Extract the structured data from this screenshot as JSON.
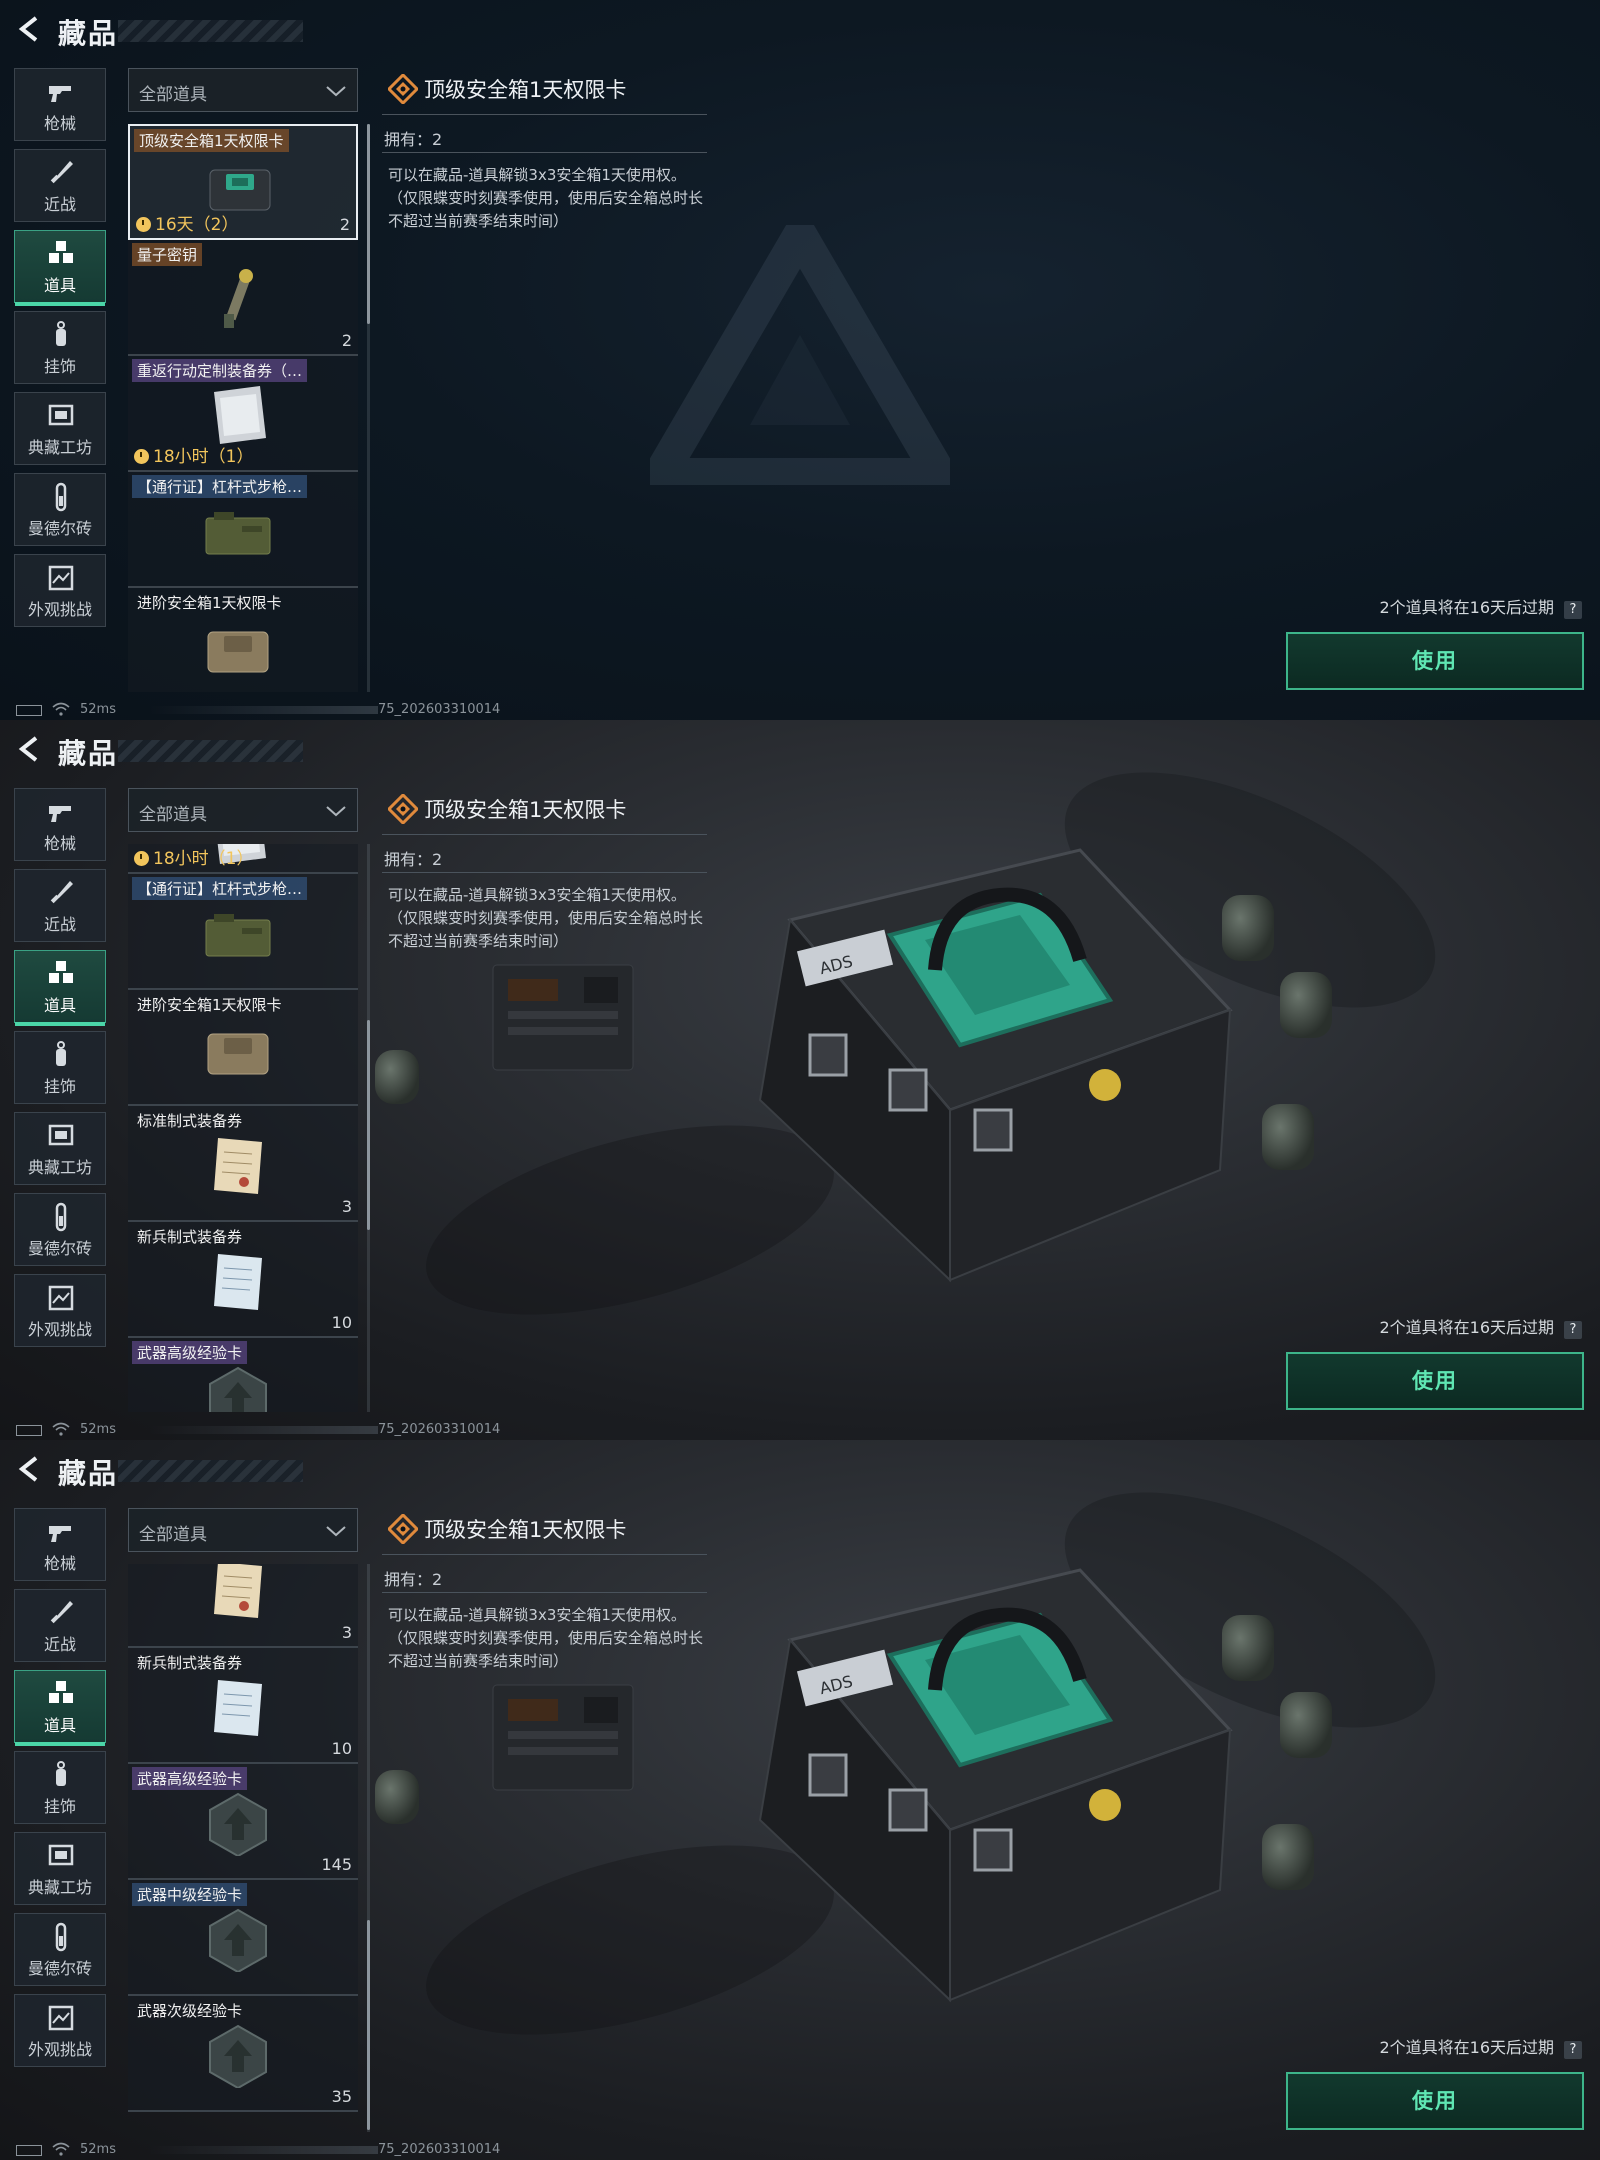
{
  "header": {
    "title": "藏品"
  },
  "categories": [
    {
      "label": "枪械",
      "icon": "gun-icon"
    },
    {
      "label": "近战",
      "icon": "knife-icon"
    },
    {
      "label": "道具",
      "icon": "cubes-icon",
      "active": true
    },
    {
      "label": "挂饰",
      "icon": "charm-icon"
    },
    {
      "label": "典藏工坊",
      "icon": "frame-icon"
    },
    {
      "label": "曼德尔砖",
      "icon": "brick-icon"
    },
    {
      "label": "外观挑战",
      "icon": "image-icon"
    }
  ],
  "filter": {
    "label": "全部道具"
  },
  "detail": {
    "title": "顶级安全箱1天权限卡",
    "own": "拥有：2",
    "description": "可以在藏品-道具解锁3x3安全箱1天使用权。（仅限蝶变时刻赛季使用，使用后安全箱总时长不超过当前赛季结束时间）"
  },
  "footer": {
    "expire_note": "2个道具将在16天后过期",
    "help": "?",
    "use_label": "使用"
  },
  "status": {
    "ping": "52ms",
    "build": "75_202603310014"
  },
  "panels": [
    {
      "items": [
        {
          "name": "顶级安全箱1天权限卡",
          "tag": "orange",
          "timer": "16天（2）",
          "count": "2",
          "selected": true,
          "thumb": "safe-case"
        },
        {
          "name": "量子密钥",
          "tag": "orange",
          "timer": "",
          "count": "2",
          "thumb": "key"
        },
        {
          "name": "重返行动定制装备券（…",
          "tag": "purple",
          "timer": "18小时（1）",
          "count": "",
          "thumb": "paper"
        },
        {
          "name": "【通行证】杠杆式步枪…",
          "tag": "blue",
          "timer": "",
          "count": "",
          "thumb": "ammo-box"
        },
        {
          "name": "进阶安全箱1天权限卡",
          "tag": "none",
          "timer": "",
          "count": "",
          "thumb": "safe-case-tan"
        }
      ]
    },
    {
      "items": [
        {
          "name": "",
          "tag": "none",
          "timer": "18小时（1）",
          "count": "",
          "thumb": "paper",
          "partial": true
        },
        {
          "name": "【通行证】杠杆式步枪…",
          "tag": "blue",
          "timer": "",
          "count": "",
          "thumb": "ammo-box"
        },
        {
          "name": "进阶安全箱1天权限卡",
          "tag": "none",
          "timer": "",
          "count": "",
          "thumb": "safe-case-tan"
        },
        {
          "name": "标准制式装备券",
          "tag": "none",
          "timer": "",
          "count": "3",
          "thumb": "doc"
        },
        {
          "name": "新兵制式装备券",
          "tag": "none",
          "timer": "",
          "count": "10",
          "thumb": "doc-blue"
        },
        {
          "name": "武器高级经验卡",
          "tag": "purple",
          "timer": "",
          "count": "",
          "thumb": "hex"
        }
      ]
    },
    {
      "items": [
        {
          "name": "",
          "tag": "none",
          "timer": "",
          "count": "3",
          "thumb": "doc",
          "partial": true
        },
        {
          "name": "新兵制式装备券",
          "tag": "none",
          "timer": "",
          "count": "10",
          "thumb": "doc-blue"
        },
        {
          "name": "武器高级经验卡",
          "tag": "purple",
          "timer": "",
          "count": "145",
          "thumb": "hex"
        },
        {
          "name": "武器中级经验卡",
          "tag": "blue",
          "timer": "",
          "count": "",
          "thumb": "hex"
        },
        {
          "name": "武器次级经验卡",
          "tag": "none",
          "timer": "",
          "count": "35",
          "thumb": "hex"
        }
      ]
    }
  ],
  "colors": {
    "accent": "#4bd6a8",
    "timer": "#f2c55c",
    "bg_dark": "#0b121a"
  },
  "case_label": "ADS"
}
